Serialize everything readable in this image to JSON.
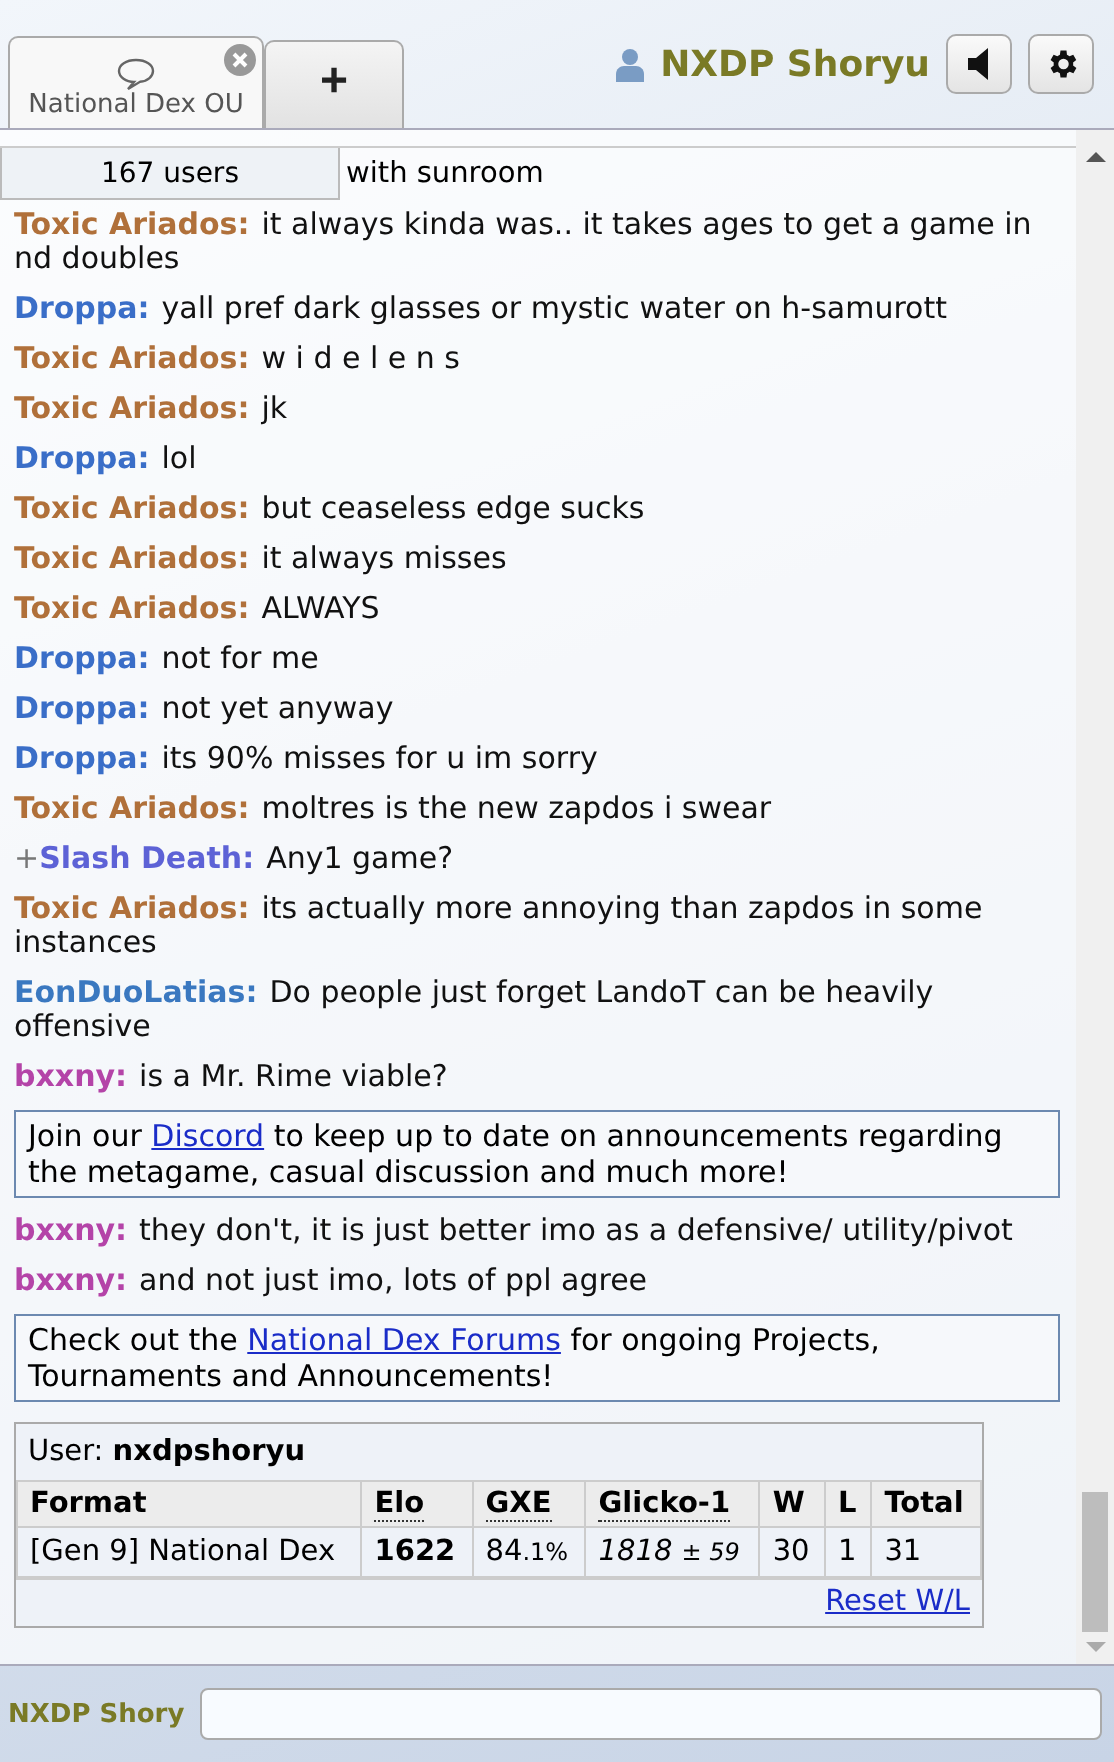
{
  "tabs": [
    {
      "label": "National Dex OU",
      "selected": true,
      "kind": "room"
    },
    {
      "label": "+",
      "selected": false,
      "kind": "new"
    }
  ],
  "user": {
    "name": "NXDP Shoryu",
    "color": "#7a7a26"
  },
  "room": {
    "users": "167 users",
    "topic_tail": "with sunroom"
  },
  "messages": [
    {
      "kind": "chat",
      "name": "Toxic Ariados:",
      "color": "#b0703a",
      "text": "it always kinda was.. it takes ages to get a game in nd doubles"
    },
    {
      "kind": "chat",
      "name": "Droppa:",
      "color": "#3a6ec8",
      "text": "yall pref dark glasses or mystic water on h-samurott"
    },
    {
      "kind": "chat",
      "name": "Toxic Ariados:",
      "color": "#b0703a",
      "text": "w i d e l e n s"
    },
    {
      "kind": "chat",
      "name": "Toxic Ariados:",
      "color": "#b0703a",
      "text": "jk"
    },
    {
      "kind": "chat",
      "name": "Droppa:",
      "color": "#3a6ec8",
      "text": "lol"
    },
    {
      "kind": "chat",
      "name": "Toxic Ariados:",
      "color": "#b0703a",
      "text": "but ceaseless edge sucks"
    },
    {
      "kind": "chat",
      "name": "Toxic Ariados:",
      "color": "#b0703a",
      "text": "it always misses"
    },
    {
      "kind": "chat",
      "name": "Toxic Ariados:",
      "color": "#b0703a",
      "text": "ALWAYS"
    },
    {
      "kind": "chat",
      "name": "Droppa:",
      "color": "#3a6ec8",
      "text": "not for me"
    },
    {
      "kind": "chat",
      "name": "Droppa:",
      "color": "#3a6ec8",
      "text": "not yet anyway"
    },
    {
      "kind": "chat",
      "name": "Droppa:",
      "color": "#3a6ec8",
      "text": "its 90% misses for u im sorry"
    },
    {
      "kind": "chat",
      "name": "Toxic Ariados:",
      "color": "#b0703a",
      "text": "moltres is the new zapdos i swear"
    },
    {
      "kind": "chat",
      "rank": "+",
      "name": "Slash Death:",
      "color": "#5d62d6",
      "text": "Any1 game?"
    },
    {
      "kind": "chat",
      "name": "Toxic Ariados:",
      "color": "#b0703a",
      "text": "its actually more annoying than zapdos in some instances"
    },
    {
      "kind": "chat",
      "name": "EonDuoLatias:",
      "color": "#3a78c0",
      "text": "Do people just forget LandoT can be heavily offensive"
    },
    {
      "kind": "chat",
      "name": "bxxny:",
      "color": "#b444a8",
      "text": "is a Mr. Rime viable?"
    },
    {
      "kind": "notice",
      "parts": [
        {
          "text": "Join our "
        },
        {
          "link": "Discord"
        },
        {
          "text": " to keep up to date on announcements regarding the metagame, casual discussion and much more!"
        }
      ]
    },
    {
      "kind": "chat",
      "name": "bxxny:",
      "color": "#b444a8",
      "text": "they don't, it is just better imo as a defensive/ utility/pivot"
    },
    {
      "kind": "chat",
      "name": "bxxny:",
      "color": "#b444a8",
      "text": "and not just imo, lots of ppl agree"
    },
    {
      "kind": "notice",
      "parts": [
        {
          "text": "Check out the "
        },
        {
          "link": "National Dex Forums"
        },
        {
          "text": " for ongoing Projects, Tournaments and Announcements!"
        }
      ]
    }
  ],
  "stats": {
    "user_label": "User:",
    "username": "nxdpshoryu",
    "columns": [
      "Format",
      "Elo",
      "GXE",
      "Glicko-1",
      "W",
      "L",
      "Total"
    ],
    "row": {
      "format": "[Gen 9] National Dex",
      "elo": "1622",
      "gxe": "84",
      "gxe_small": ".1%",
      "glicko": "1818",
      "glicko_dev": "± 59",
      "w": "30",
      "l": "1",
      "total": "31"
    },
    "reset": "Reset W/L"
  },
  "compose": {
    "name": "NXDP Shory"
  }
}
